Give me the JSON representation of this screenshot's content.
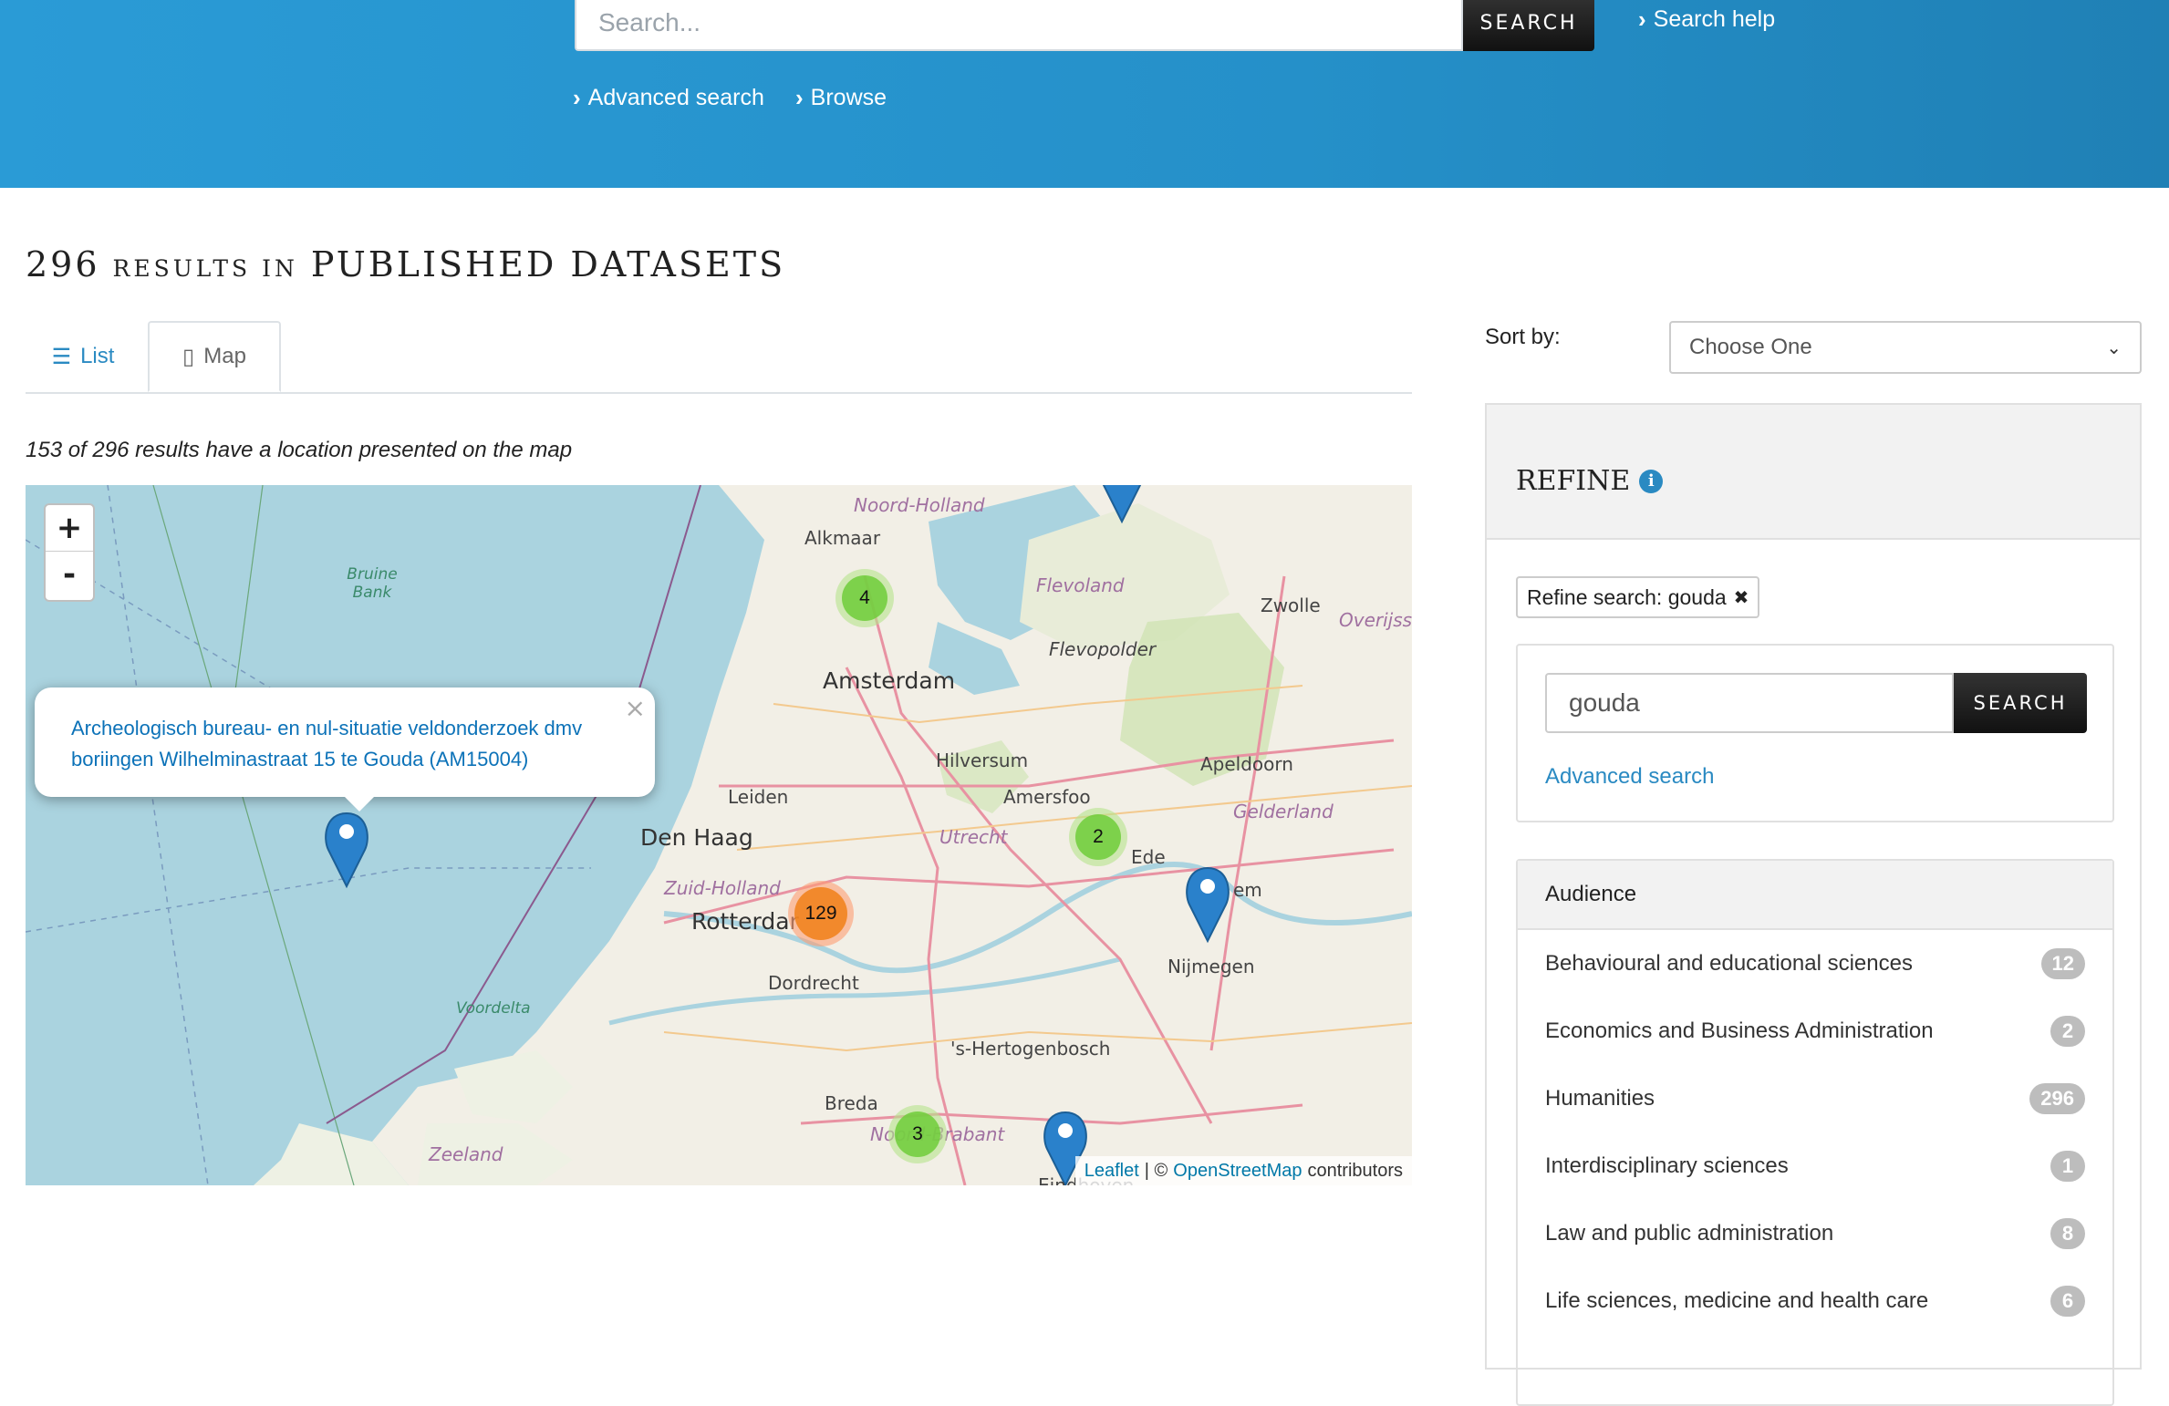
{
  "header": {
    "search_placeholder": "Search...",
    "search_button": "SEARCH",
    "search_help": "Search help",
    "advanced_search": "Advanced search",
    "browse": "Browse",
    "background_color": "#2590c9"
  },
  "results": {
    "count": "296",
    "label_small": "RESULTS IN",
    "label_big": "PUBLISHED DATASETS"
  },
  "tabs": {
    "list": "List",
    "map": "Map",
    "active": "Map"
  },
  "map": {
    "note": "153 of 296 results have a location presented on the map",
    "zoom_in": "+",
    "zoom_out": "-",
    "popup_text": "Archeologisch bureau- en nul-situatie veldonderzoek dmv boriingen Wilhelminastraat 15 te Gouda (AM15004)",
    "popup_close": "×",
    "clusters": [
      {
        "count": "4",
        "color": "green"
      },
      {
        "count": "2",
        "color": "green"
      },
      {
        "count": "129",
        "color": "orange"
      },
      {
        "count": "3",
        "color": "green"
      }
    ],
    "labels": {
      "noord_holland": "Noord-Holland",
      "alkmaar": "Alkmaar",
      "flevoland": "Flevoland",
      "zwolle": "Zwolle",
      "overijssel": "Overijss",
      "flevopolder": "Flevopolder",
      "amsterdam": "Amsterdam",
      "bruine_bank": "Bruine Bank",
      "hilversum": "Hilversum",
      "apeldoorn": "Apeldoorn",
      "leiden": "Leiden",
      "amersfoort": "Amersfoo",
      "gelderland": "Gelderland",
      "den_haag": "Den Haag",
      "utrecht": "Utrecht",
      "ede": "Ede",
      "zuid_holland": "Zuid-Holland",
      "rotterdam": "Rotterdar",
      "arnhem": "em",
      "nijmegen": "Nijmegen",
      "voordelta": "Voordelta",
      "dordrecht": "Dordrecht",
      "hertogenbosch": "'s-Hertogenbosch",
      "breda": "Breda",
      "noord_brabant": "Noord-Brabant",
      "zeeland": "Zeeland",
      "eindhoven": "Eindhoven"
    },
    "attribution": {
      "leaflet": "Leaflet",
      "separator": "| ©",
      "osm": "OpenStreetMap",
      "contributors": "contributors"
    }
  },
  "sort": {
    "label": "Sort by:",
    "selected": "Choose One"
  },
  "refine": {
    "title": "REFINE",
    "info_icon": "i",
    "chip_label": "Refine search: gouda",
    "chip_remove": "✖",
    "input_value": "gouda",
    "button": "SEARCH",
    "advanced_search": "Advanced search"
  },
  "audience": {
    "title": "Audience",
    "items": [
      {
        "label": "Behavioural and educational sciences",
        "count": "12"
      },
      {
        "label": "Economics and Business Administration",
        "count": "2"
      },
      {
        "label": "Humanities",
        "count": "296"
      },
      {
        "label": "Interdisciplinary sciences",
        "count": "1"
      },
      {
        "label": "Law and public administration",
        "count": "8"
      },
      {
        "label": "Life sciences, medicine and health care",
        "count": "6"
      }
    ]
  }
}
